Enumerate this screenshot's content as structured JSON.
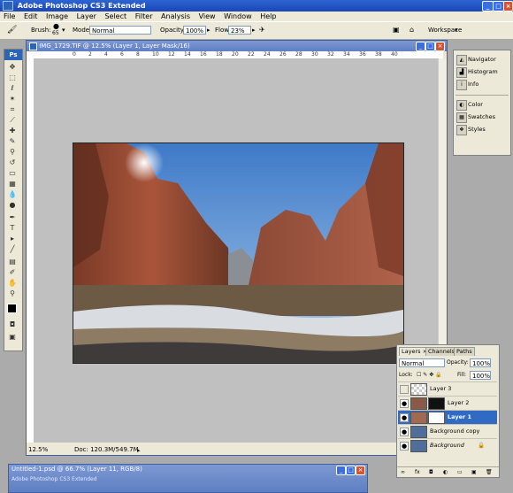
{
  "app": {
    "title": "Adobe Photoshop CS3 Extended"
  },
  "menu": [
    "File",
    "Edit",
    "Image",
    "Layer",
    "Select",
    "Filter",
    "Analysis",
    "View",
    "Window",
    "Help"
  ],
  "options": {
    "brush_label": "Brush:",
    "brush_size": "65",
    "mode_label": "Mode:",
    "mode_value": "Normal",
    "opacity_label": "Opacity:",
    "opacity_value": "100%",
    "flow_label": "Flow:",
    "flow_value": "23%",
    "workspace_label": "Workspace"
  },
  "toolbox": {
    "ps_label": "Ps"
  },
  "document": {
    "title": "IMG_1729.TIF @ 12.5% (Layer 1, Layer Mask/16)",
    "zoom": "12.5%",
    "doc_size": "Doc: 120.3M/549.7M",
    "ruler_ticks": [
      "0",
      "2",
      "4",
      "6",
      "8",
      "10",
      "12",
      "14",
      "16",
      "18",
      "20",
      "22",
      "24",
      "26",
      "28",
      "30",
      "32",
      "34",
      "36",
      "38",
      "40"
    ]
  },
  "dock": {
    "items": [
      "Navigator",
      "Histogram",
      "Info",
      "Color",
      "Swatches",
      "Styles"
    ]
  },
  "layers_panel": {
    "tabs": [
      "Layers ×",
      "Channels",
      "Paths"
    ],
    "blend_mode": "Normal",
    "opacity_label": "Opacity:",
    "opacity_value": "100%",
    "lock_label": "Lock:",
    "fill_label": "Fill:",
    "fill_value": "100%",
    "layers": [
      {
        "name": "Layer 3"
      },
      {
        "name": "Layer 2"
      },
      {
        "name": "Layer 1"
      },
      {
        "name": "Background copy"
      },
      {
        "name": "Background"
      }
    ]
  },
  "second_doc": {
    "title": "Untitled-1.psd @ 66.7% (Layer 11, RGB/8)",
    "subtitle": "Adobe Photoshop CS3 Extended"
  },
  "colors": {
    "title_bar": "#1f4fbf",
    "selection": "#316ac5",
    "chrome": "#ece9d8"
  }
}
